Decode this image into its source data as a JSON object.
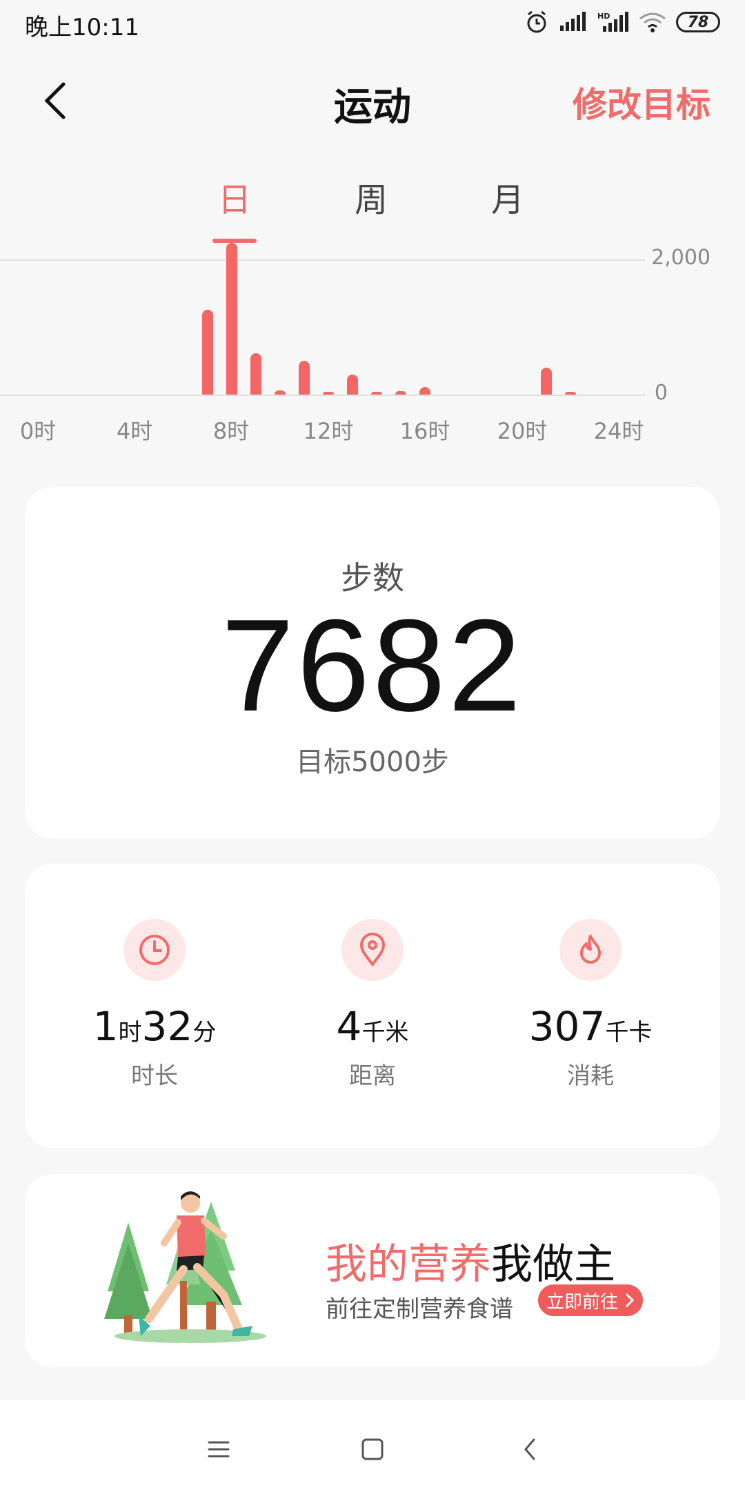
{
  "status": {
    "time": "晚上10:11",
    "battery": "78",
    "signal_label": "HD"
  },
  "header": {
    "title": "运动",
    "edit_goal": "修改目标"
  },
  "tabs": [
    {
      "label": "日"
    },
    {
      "label": "周"
    },
    {
      "label": "月"
    }
  ],
  "active_tab": 0,
  "chart_data": {
    "type": "bar",
    "x_tick_labels": [
      "0时",
      "4时",
      "8时",
      "12时",
      "16时",
      "20时",
      "24时"
    ],
    "y_tick_labels": [
      "2,000",
      "0"
    ],
    "ylim": [
      0,
      2000
    ],
    "bars": [
      {
        "hour": 7,
        "value": 1260
      },
      {
        "hour": 8,
        "value": 2250
      },
      {
        "hour": 9,
        "value": 610
      },
      {
        "hour": 10,
        "value": 60
      },
      {
        "hour": 11,
        "value": 500
      },
      {
        "hour": 12,
        "value": 30
      },
      {
        "hour": 13,
        "value": 300
      },
      {
        "hour": 14,
        "value": 40
      },
      {
        "hour": 15,
        "value": 50
      },
      {
        "hour": 16,
        "value": 110
      },
      {
        "hour": 21,
        "value": 400
      },
      {
        "hour": 22,
        "value": 20
      }
    ]
  },
  "steps": {
    "title": "步数",
    "value": "7682",
    "goal": "目标5000步"
  },
  "stats": [
    {
      "icon": "clock-icon",
      "value_h": "1",
      "unit_h": "时",
      "value_m": "32",
      "unit_m": "分",
      "label": "时长"
    },
    {
      "icon": "location-pin-icon",
      "value": "4",
      "unit": "千米",
      "label": "距离"
    },
    {
      "icon": "flame-icon",
      "value": "307",
      "unit": "千卡",
      "label": "消耗"
    }
  ],
  "promo": {
    "title_accent": "我的营养",
    "title_rest": "我做主",
    "subtitle": "前往定制营养食谱",
    "button": "立即前往"
  },
  "colors": {
    "accent": "#f06c6a",
    "bar": "#f56565",
    "icon_bg": "#fde8e7"
  }
}
